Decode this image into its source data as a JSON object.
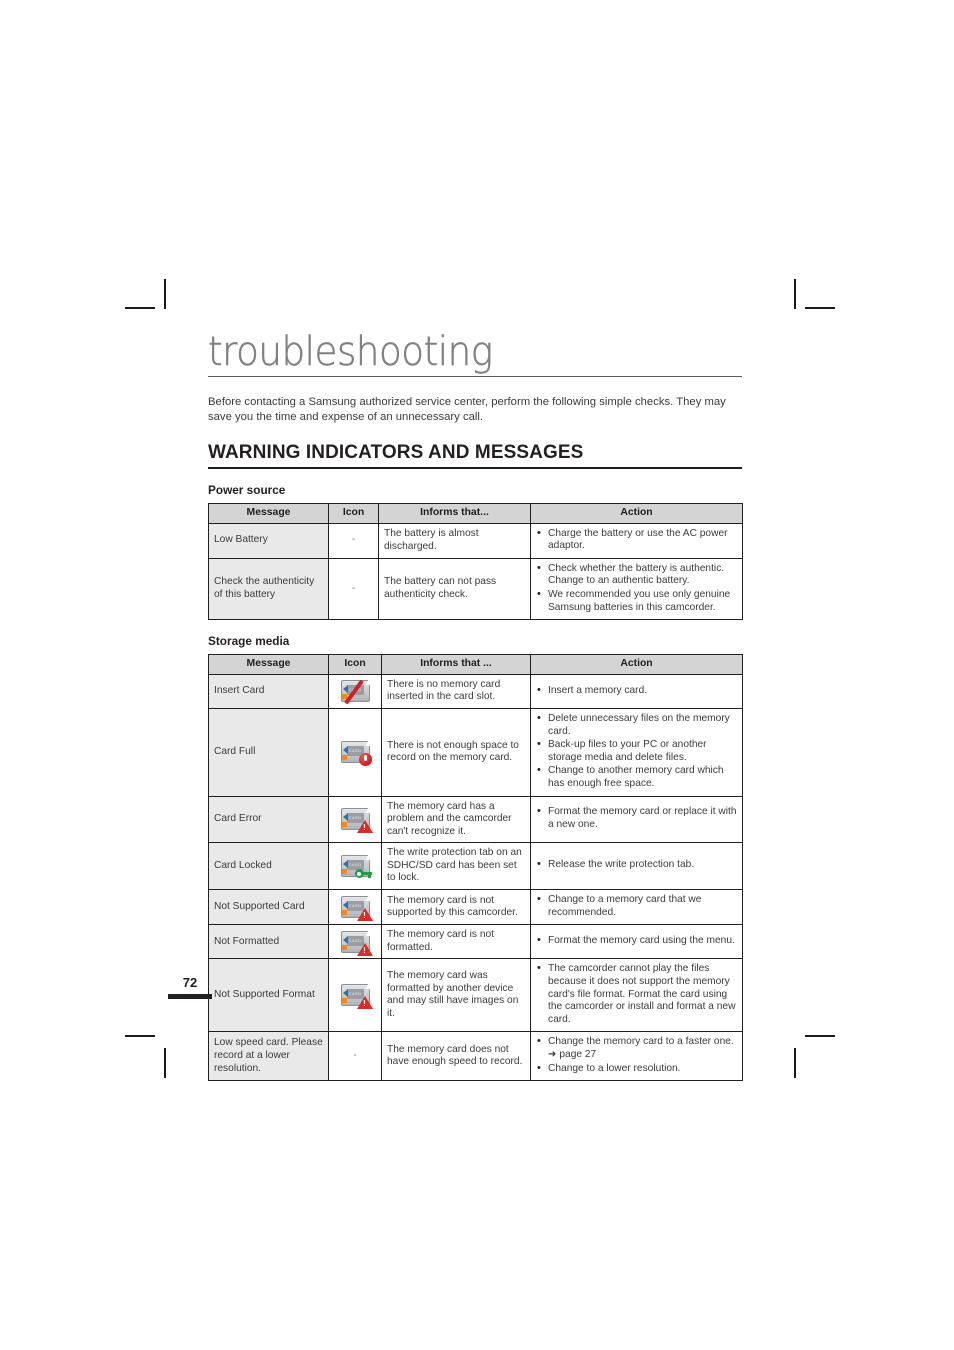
{
  "document": {
    "chapter_title": "troubleshooting",
    "intro": "Before contacting a Samsung authorized service center, perform the following simple checks. They may save you the time and expense of an unnecessary call.",
    "section_heading": "WARNING INDICATORS AND MESSAGES",
    "page_number": "72"
  },
  "power_source": {
    "subheading": "Power source",
    "columns": [
      "Message",
      "Icon",
      "Informs that...",
      "Action"
    ],
    "rows": [
      {
        "message": "Low Battery",
        "icon": "-",
        "icon_type": "dash",
        "informs": "The battery is almost discharged.",
        "actions": [
          "Charge the battery or use the AC power adaptor."
        ]
      },
      {
        "message": "Check the authenticity of this battery",
        "icon": "-",
        "icon_type": "dash",
        "informs": "The battery can not pass authenticity check.",
        "actions": [
          "Check whether the battery is authentic. Change to an authentic battery.",
          "We recommended you use only genuine Samsung batteries in this camcorder."
        ]
      }
    ]
  },
  "storage_media": {
    "subheading": "Storage media",
    "columns": [
      "Message",
      "Icon",
      "Informs that ...",
      "Action"
    ],
    "rows": [
      {
        "message": "Insert Card",
        "icon_type": "card-slash",
        "icon_label": "CARD",
        "informs": "There is no memory card inserted in the card slot.",
        "actions": [
          "Insert a memory card."
        ]
      },
      {
        "message": "Card Full",
        "icon_type": "card-dot",
        "icon_label": "CARD",
        "informs": "There is not enough space to record on the memory card.",
        "actions": [
          "Delete unnecessary files on the memory card.",
          "Back-up files to your PC or another storage media and delete files.",
          "Change to another memory card which has enough free space."
        ]
      },
      {
        "message": "Card Error",
        "icon_type": "card-warning",
        "icon_label": "CARD",
        "informs": "The memory card has a problem and the camcorder can't recognize it.",
        "actions": [
          "Format the memory card or replace it with a new one."
        ]
      },
      {
        "message": "Card Locked",
        "icon_type": "card-key",
        "icon_label": "CARD",
        "informs": "The write protection tab on an SDHC/SD card has been set to lock.",
        "actions": [
          "Release the write protection tab."
        ]
      },
      {
        "message": "Not Supported Card",
        "icon_type": "card-warning",
        "icon_label": "CARD",
        "informs": "The memory card is not supported by this camcorder.",
        "actions": [
          "Change to a memory card that we recommended."
        ]
      },
      {
        "message": "Not Formatted",
        "icon_type": "card-warning",
        "icon_label": "CARD",
        "informs": "The memory card is not formatted.",
        "actions": [
          "Format the memory card using the menu."
        ]
      },
      {
        "message": "Not Supported Format",
        "icon_type": "card-warning",
        "icon_label": "CARD",
        "informs": "The memory card was formatted by another device and may still have images on it.",
        "actions": [
          "The camcorder cannot play the files because it does not support the memory card's file format. Format the card using the camcorder or install and format a new card."
        ]
      },
      {
        "message": "Low speed card. Please record at a lower resolution.",
        "icon": "-",
        "icon_type": "dash",
        "informs": "The memory card does not have enough speed to record.",
        "actions": [
          "Change the memory card to a faster one. ➜ page 27",
          "Change to a lower resolution."
        ]
      }
    ]
  }
}
